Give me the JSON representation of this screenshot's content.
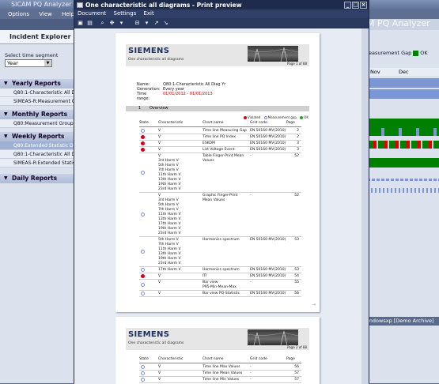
{
  "bg_app": {
    "title": "SICAM PQ Analyzer",
    "menu": [
      "Options",
      "View",
      "Help"
    ],
    "big_title": "M PQ Analyzer",
    "measurement_gap_label": "easurement Gap",
    "ok_label": "OK",
    "months": [
      "Nov",
      "Dec"
    ],
    "status_text": "indowsxp [Demo Archive]",
    "colors": {
      "ok": "#008000",
      "gap": "#e00000",
      "light": "#7a96d4"
    }
  },
  "explorer": {
    "title": "Incident Explorer",
    "segment_label": "Select time segment",
    "segment_value": "Year",
    "groups": [
      {
        "label": "Yearly Reports",
        "items": [
          "Q80:1-Characteristic All Diag",
          "SIMEAS-R:Measurement Grou"
        ]
      },
      {
        "label": "Monthly Reports",
        "items": [
          "Q80:Measurement Group"
        ]
      },
      {
        "label": "Weekly Reports",
        "items": [
          "Q80:Extended Statistic Diagr",
          "Q80:1-Characteristic All Diag",
          "SIMEAS-R:Extended Statistic"
        ]
      },
      {
        "label": "Daily Reports",
        "items": []
      }
    ]
  },
  "preview": {
    "title": "One characteristic all diagrams - Print preview",
    "menu": [
      "Document",
      "Settings",
      "Exit"
    ],
    "tools": [
      "print-icon",
      "export-icon",
      "zoom-icon",
      "fit-width-icon",
      "fit-page-icon",
      "zoom-out-icon",
      "zoom-in-icon"
    ]
  },
  "page1": {
    "brand": "SIEMENS",
    "subtitle": "One characteristic all diagrams",
    "page_no": "Page 1 of 88",
    "name_label": "Name:",
    "name_value": "Q80:1-Characteristic All Diag Yr",
    "generation_label": "Generation:",
    "generation_value": "Every year",
    "time_label": "Time range:",
    "time_value": "01/01/2012 - 01/01/2013",
    "section_no": "1",
    "section_title": "Overview",
    "legend": [
      "Violated",
      "Measurement gap",
      "OK"
    ],
    "columns": [
      "State",
      "Characteristic",
      "Chart name",
      "Grid code",
      "Page"
    ],
    "rows": [
      {
        "state": "ok",
        "char": "V",
        "chart": "Time line Measuring Gap",
        "grid": "EN 50160 MV(2010)",
        "page": "2"
      },
      {
        "state": "viol",
        "char": "V",
        "chart": "Time line PQ Index",
        "grid": "EN 50160 MV(2010)",
        "page": "2"
      },
      {
        "state": "viol",
        "char": "V",
        "chart": "ESKOM",
        "grid": "EN 50160 MV(2010)",
        "page": "3"
      },
      {
        "state": "viol",
        "char": "V",
        "chart": "List Voltage Event",
        "grid": "EN 50160 MV(2010)",
        "page": "3"
      },
      {
        "state": "ok",
        "char": "V\n3rd Harm V\n5th Harm V\n7th Harm V\n11th Harm V\n13th Harm V\n19th Harm V\n23rd Harm V",
        "chart": "Table Finger-Print Mean\nValues",
        "grid": "-",
        "page": "52"
      },
      {
        "state": "ok",
        "char": "V\n3rd Harm V\n5th Harm V\n7th Harm V\n11th Harm V\n13th Harm V\n17th Harm V\n19th Harm V\n23rd Harm V",
        "chart": "Graphic Finger-Print\nMean Values",
        "grid": "-",
        "page": "52"
      },
      {
        "state": "ok",
        "char": "5th Harm V\n7th Harm V\n11th Harm V\n13th Harm V\n19th Harm V\n23rd Harm V",
        "chart": "Harmonics spectrum",
        "grid": "EN 50160 MV(2010)",
        "page": "53"
      },
      {
        "state": "ok",
        "char": "17th Harm V",
        "chart": "Harmonics spectrum",
        "grid": "EN 50160 MV(2010)",
        "page": "53"
      },
      {
        "state": "viol",
        "char": "V",
        "chart": "ITI",
        "grid": "EN 50160 MV(2010)",
        "page": "54"
      },
      {
        "state": "ok",
        "char": "V",
        "chart": "Bar view\nP95-Min-Mean-Max",
        "grid": "-",
        "page": "55"
      },
      {
        "state": "ok",
        "char": "V",
        "chart": "Bar view PQ-Statistic",
        "grid": "EN 50160 MV(2010)",
        "page": "56"
      }
    ]
  },
  "page2": {
    "brand": "SIEMENS",
    "subtitle": "One characteristic all diagrams",
    "page_no": "Page 2 of 88",
    "columns": [
      "State",
      "Characteristic",
      "Chart name",
      "Grid code",
      "Page"
    ],
    "rows": [
      {
        "state": "ok",
        "char": "V",
        "chart": "Time line Max Values",
        "grid": "-",
        "page": "56"
      },
      {
        "state": "ok",
        "char": "V",
        "chart": "Time line Mean Values",
        "grid": "-",
        "page": "57"
      },
      {
        "state": "ok",
        "char": "V",
        "chart": "Time line Min Values",
        "grid": "-",
        "page": "57"
      }
    ]
  }
}
